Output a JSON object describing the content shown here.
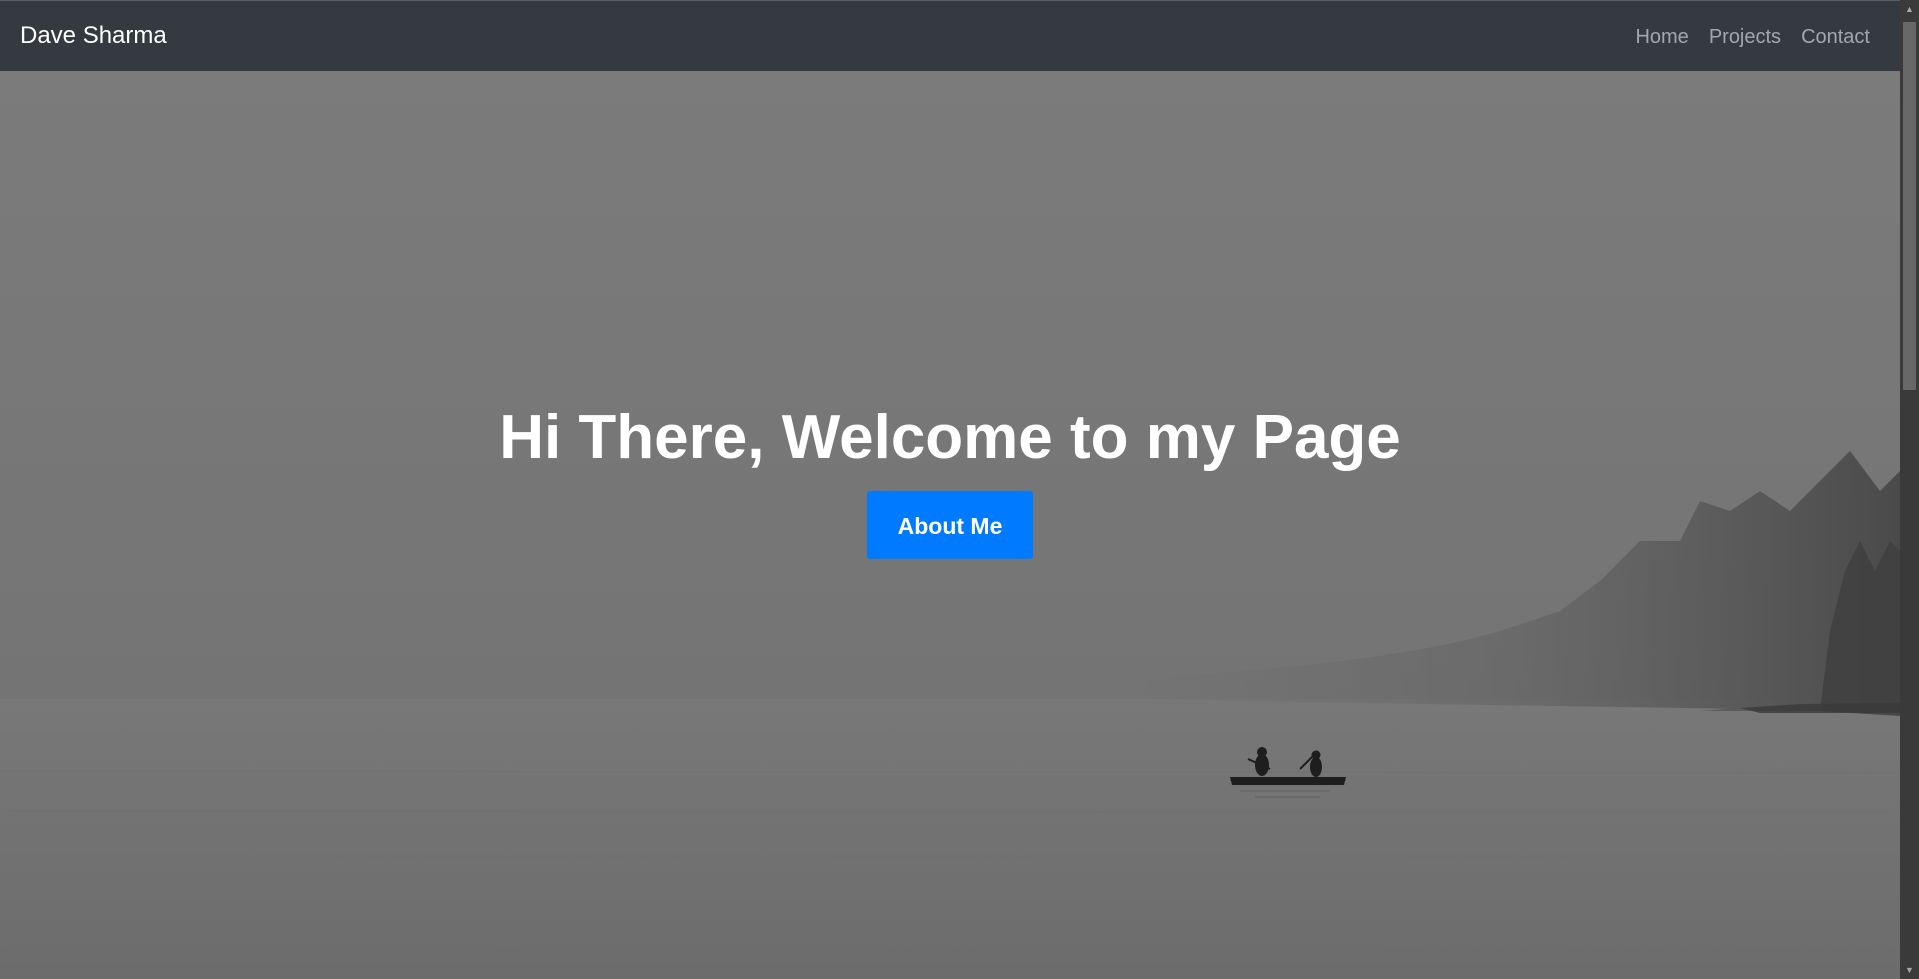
{
  "navbar": {
    "brand": "Dave Sharma",
    "links": [
      "Home",
      "Projects",
      "Contact"
    ]
  },
  "hero": {
    "title": "Hi There, Welcome to my Page",
    "button_label": "About Me"
  },
  "colors": {
    "navbar_bg": "#343a40",
    "button_bg": "#007bff",
    "hero_overlay": "#7a7a7a"
  },
  "icons": {
    "scroll_up": "chevron-up-icon",
    "scroll_down": "chevron-down-icon"
  }
}
